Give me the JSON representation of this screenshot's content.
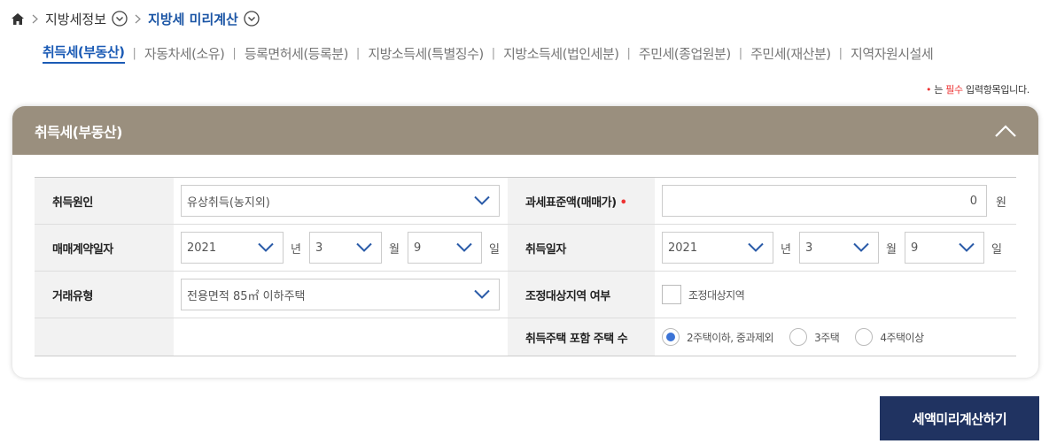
{
  "breadcrumb": {
    "item1": "지방세정보",
    "item2": "지방세 미리계산"
  },
  "tabs": [
    {
      "label": "취득세(부동산)",
      "active": true
    },
    {
      "label": "자동차세(소유)"
    },
    {
      "label": "등록면허세(등록분)"
    },
    {
      "label": "지방소득세(특별징수)"
    },
    {
      "label": "지방소득세(법인세분)"
    },
    {
      "label": "주민세(종업원분)"
    },
    {
      "label": "주민세(재산분)"
    },
    {
      "label": "지역자원시설세"
    }
  ],
  "required_note": {
    "dot": "•",
    "prefix": "는 ",
    "required": "필수",
    "suffix": " 입력항목입니다."
  },
  "panel": {
    "title": "취득세(부동산)"
  },
  "form": {
    "cause_label": "취득원인",
    "cause_value": "유상취득(농지외)",
    "tax_base_label": "과세표준액(매매가)",
    "tax_base_value": "0",
    "tax_base_unit": "원",
    "contract_date_label": "매매계약일자",
    "contract_year": "2021",
    "contract_month": "3",
    "contract_day": "9",
    "acq_date_label": "취득일자",
    "acq_year": "2021",
    "acq_month": "3",
    "acq_day": "9",
    "unit_year": "년",
    "unit_month": "월",
    "unit_day": "일",
    "trade_type_label": "거래유형",
    "trade_type_value": "전용면적 85㎡ 이하주택",
    "adjust_region_label": "조정대상지역 여부",
    "adjust_region_checkbox": "조정대상지역",
    "house_count_label": "취득주택 포함 주택 수",
    "house_options": [
      "2주택이하, 중과제외",
      "3주택",
      "4주택이상"
    ],
    "house_selected": 0
  },
  "calc_button": "세액미리계산하기",
  "colors": {
    "accent": "#1b5bb5",
    "panel_header": "#9a8f7e",
    "button": "#203361",
    "required": "#e33333"
  }
}
